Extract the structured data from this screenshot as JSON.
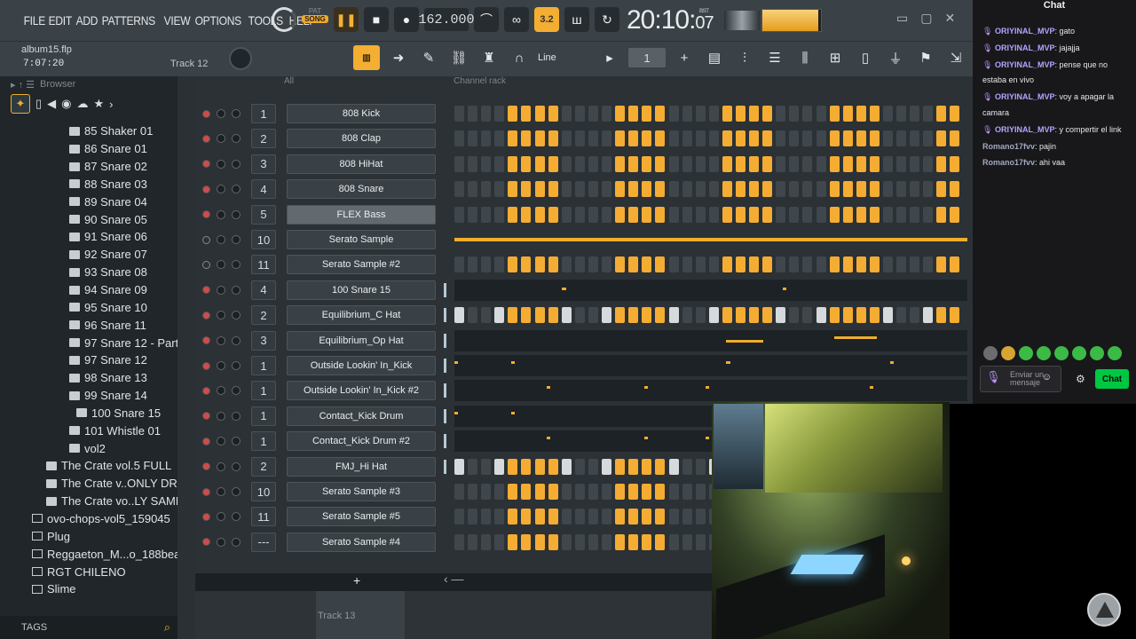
{
  "menu": [
    "FILE",
    "EDIT",
    "ADD",
    "PATTERNS",
    "VIEW",
    "OPTIONS",
    "TOOLS",
    "HELP"
  ],
  "transport": {
    "mode_pat": "PAT",
    "mode_song": "SONG",
    "tempo": "162.000",
    "clock": "20:10",
    "clock_sub": "07",
    "clock_unit": "B:S:T",
    "bar_label": "3.2"
  },
  "project": {
    "file": "album15.flp",
    "time": "7:07:20",
    "track": "Track 12"
  },
  "toolbar": {
    "snap": "Line",
    "pattern": "1"
  },
  "browser": {
    "title": "Browser",
    "tags": "TAGS",
    "items": [
      {
        "label": "85 Shaker 01",
        "k": "fi",
        "i": 78
      },
      {
        "label": "86 Snare 01",
        "k": "fi",
        "i": 78
      },
      {
        "label": "87 Snare 02",
        "k": "fi",
        "i": 78
      },
      {
        "label": "88 Snare 03",
        "k": "fi",
        "i": 78
      },
      {
        "label": "89 Snare 04",
        "k": "fi",
        "i": 78
      },
      {
        "label": "90 Snare 05",
        "k": "fi",
        "i": 78
      },
      {
        "label": "91 Snare 06",
        "k": "fi",
        "i": 78
      },
      {
        "label": "92 Snare 07",
        "k": "fi",
        "i": 78
      },
      {
        "label": "93 Snare 08",
        "k": "fi",
        "i": 78
      },
      {
        "label": "94 Snare 09",
        "k": "fi",
        "i": 78
      },
      {
        "label": "95 Snare 10",
        "k": "fi",
        "i": 78
      },
      {
        "label": "96 Snare 11",
        "k": "fi",
        "i": 78
      },
      {
        "label": "97 Snare 12 - Part_1",
        "k": "fi",
        "i": 78
      },
      {
        "label": "97 Snare 12",
        "k": "fi",
        "i": 78
      },
      {
        "label": "98 Snare 13",
        "k": "fi",
        "i": 78
      },
      {
        "label": "99 Snare 14",
        "k": "fi",
        "i": 78
      },
      {
        "label": "100 Snare 15",
        "k": "fi",
        "i": 86
      },
      {
        "label": "101 Whistle 01",
        "k": "fi",
        "i": 78
      },
      {
        "label": "vol2",
        "k": "fi",
        "i": 78
      },
      {
        "label": "The Crate vol.5 FULL",
        "k": "fi",
        "i": 52
      },
      {
        "label": "The Crate v..ONLY DRUMS",
        "k": "fi",
        "i": 52
      },
      {
        "label": "The Crate vo..LY SAMPLES",
        "k": "fi",
        "i": 52
      },
      {
        "label": "ovo-chops-vol5_159045",
        "k": "fo",
        "i": 36
      },
      {
        "label": "Plug",
        "k": "fo",
        "i": 36
      },
      {
        "label": "Reggaeton_M...o_188beats",
        "k": "fo",
        "i": 36
      },
      {
        "label": "RGT CHILENO",
        "k": "fo",
        "i": 36
      },
      {
        "label": "Slime",
        "k": "fo",
        "i": 36
      }
    ]
  },
  "rack": {
    "filter": "All",
    "title": "Channel rack",
    "add": "+",
    "channels": [
      {
        "n": "1",
        "name": "808 Kick",
        "t": "steps",
        "led": true
      },
      {
        "n": "2",
        "name": "808 Clap",
        "t": "steps",
        "led": true
      },
      {
        "n": "3",
        "name": "808 HiHat",
        "t": "steps",
        "led": true
      },
      {
        "n": "4",
        "name": "808 Snare",
        "t": "steps",
        "led": true
      },
      {
        "n": "5",
        "name": "FLEX Bass",
        "t": "steps",
        "led": true,
        "sel": true
      },
      {
        "n": "10",
        "name": "Serato Sample",
        "t": "line",
        "led": false
      },
      {
        "n": "11",
        "name": "Serato Sample #2",
        "t": "steps",
        "led": false
      },
      {
        "n": "4",
        "name": "100 Snare 15",
        "t": "roll",
        "notes": [
          [
            0.21,
            0.2
          ],
          [
            0.64,
            0.2
          ]
        ],
        "led": true
      },
      {
        "n": "2",
        "name": "Equilibrium_C Hat",
        "t": "steps2",
        "led": true
      },
      {
        "n": "3",
        "name": "Equilibrium_Op Hat",
        "t": "roll",
        "notes": [
          [
            0.53,
            -0.3,
            7
          ],
          [
            0.74,
            0.5,
            8
          ]
        ],
        "led": true
      },
      {
        "n": "1",
        "name": "Outside Lookin' In_Kick",
        "t": "roll",
        "notes": [
          [
            0.0,
            0.5
          ],
          [
            0.11,
            0.5
          ],
          [
            0.53,
            0.5
          ],
          [
            0.85,
            0.5
          ]
        ],
        "led": true
      },
      {
        "n": "1",
        "name": "Outside Lookin' In_Kick #2",
        "t": "roll",
        "notes": [
          [
            0.18,
            0.5
          ],
          [
            0.37,
            0.5
          ],
          [
            0.49,
            0.5
          ],
          [
            0.81,
            0.5
          ]
        ],
        "led": true
      },
      {
        "n": "1",
        "name": "Contact_Kick Drum",
        "t": "roll",
        "notes": [
          [
            0.0,
            0.5
          ],
          [
            0.11,
            0.5
          ]
        ],
        "led": true
      },
      {
        "n": "1",
        "name": "Contact_Kick Drum #2",
        "t": "roll",
        "notes": [
          [
            0.18,
            0.5
          ],
          [
            0.37,
            0.5
          ],
          [
            0.49,
            0.5
          ]
        ],
        "led": true
      },
      {
        "n": "2",
        "name": "FMJ_Hi Hat",
        "t": "steps2",
        "led": true
      },
      {
        "n": "10",
        "name": "Serato Sample #3",
        "t": "steps",
        "led": true
      },
      {
        "n": "11",
        "name": "Serato Sample #5",
        "t": "steps",
        "led": true
      },
      {
        "n": "---",
        "name": "Serato Sample #4",
        "t": "steps",
        "led": true
      }
    ]
  },
  "playlist": {
    "track": "Track 13"
  },
  "chat": {
    "title": "Chat",
    "messages": [
      {
        "user": "ORIYINAL_MVP",
        "text": ": gato",
        "mic": true
      },
      {
        "user": "ORIYINAL_MVP",
        "text": ": jajajja",
        "mic": true
      },
      {
        "user": "ORIYINAL_MVP",
        "text": ": pense que no estaba en vivo",
        "mic": true
      },
      {
        "user": "ORIYINAL_MVP",
        "text": ": voy a apagar la camara",
        "mic": true
      },
      {
        "user": "ORIYINAL_MVP",
        "text": ": y compertir el link",
        "mic": true
      },
      {
        "user": "Romano17fvv",
        "text": ": pajin",
        "mic": false
      },
      {
        "user": "Romano17fvv",
        "text": ": ahi vaa",
        "mic": false
      }
    ],
    "placeholder": "Enviar un mensaje",
    "send": "Chat"
  }
}
